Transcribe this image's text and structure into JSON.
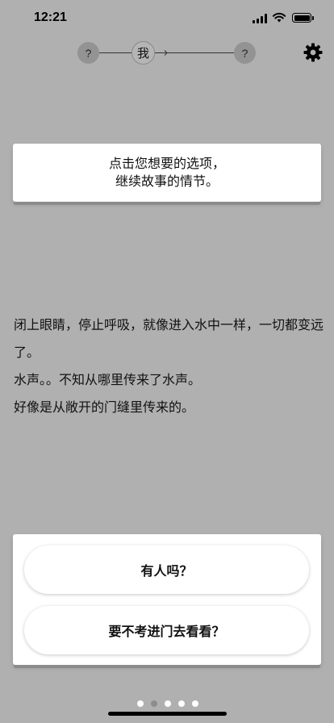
{
  "status_bar": {
    "time": "12:21"
  },
  "progress_nav": {
    "nodes": [
      {
        "label": "?"
      },
      {
        "label": "我"
      },
      {
        "label": "?"
      }
    ]
  },
  "icons": {
    "settings": "gear-icon",
    "wifi": "wifi-icon",
    "battery": "battery-icon",
    "signal": "signal-icon"
  },
  "hint_card": {
    "line1": "点击您想要的选项，",
    "line2": "继续故事的情节。"
  },
  "story": {
    "paragraphs": [
      "闭上眼睛，停止呼吸，就像进入水中一样，一切都变远了。",
      "水声。。不知从哪里传来了水声。",
      "好像是从敞开的门缝里传来的。"
    ]
  },
  "choices": [
    {
      "label": "有人吗？"
    },
    {
      "label": "要不考进门去看看？"
    }
  ],
  "pager": {
    "count": 5,
    "active_index": 1
  },
  "colors": {
    "background": "#b0b0b0",
    "card": "#ffffff",
    "dot_active": "#8d8d8d"
  }
}
